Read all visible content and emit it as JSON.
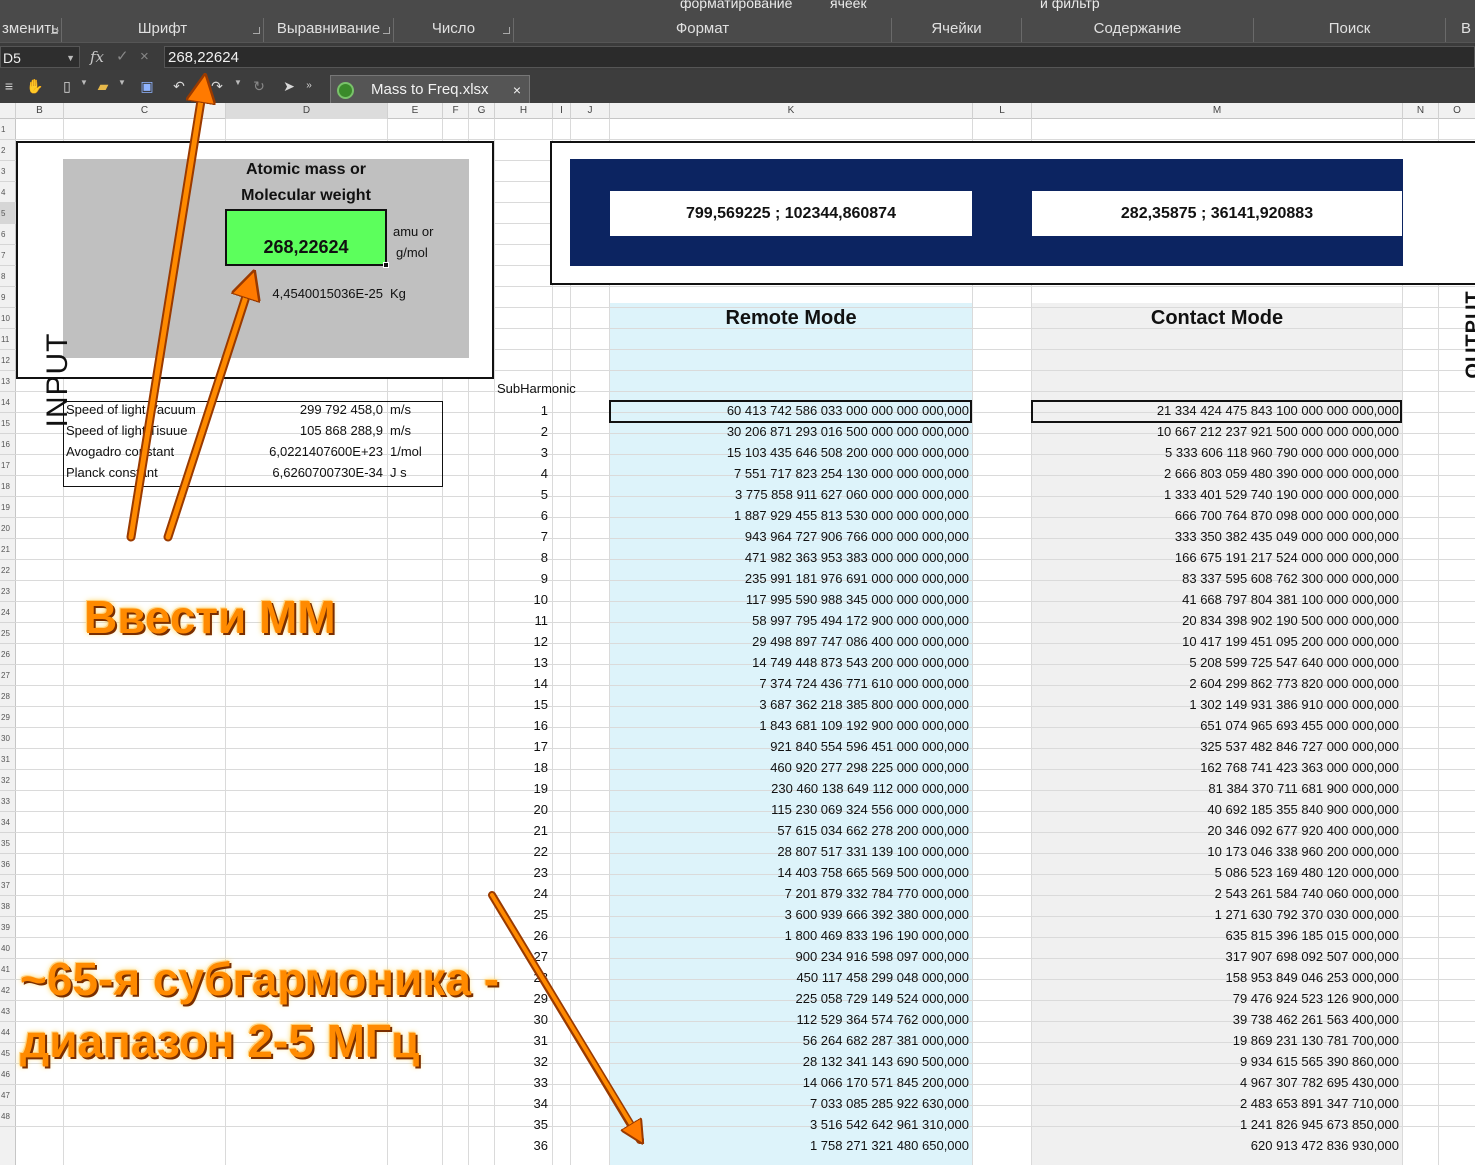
{
  "ribbon": {
    "top_labels": [
      "форматирование",
      "ячеек",
      "и фильтр"
    ],
    "groups": [
      "зменить",
      "Шрифт",
      "Выравнивание",
      "Число",
      "Формат",
      "Ячейки",
      "Содержание",
      "Поиск",
      "В"
    ]
  },
  "formula_bar": {
    "name_box": "D5",
    "fx_label": "fx",
    "value": "268,22624"
  },
  "toolbar": {
    "doc_tab_title": "Mass to Freq.xlsx",
    "doc_tab_close": "×"
  },
  "columns": [
    "B",
    "C",
    "D",
    "E",
    "F",
    "G",
    "H",
    "I",
    "J",
    "K",
    "L",
    "M",
    "N",
    "O"
  ],
  "rows": [
    "1",
    "2",
    "3",
    "4",
    "5",
    "6",
    "7",
    "8",
    "9",
    "10",
    "11",
    "12",
    "13",
    "14",
    "15",
    "16",
    "17",
    "18",
    "19",
    "20",
    "21",
    "22",
    "23",
    "24",
    "25",
    "26",
    "27",
    "28",
    "29",
    "30",
    "31",
    "32",
    "33",
    "34",
    "35",
    "36",
    "37",
    "38",
    "39",
    "40",
    "41",
    "42",
    "43",
    "44",
    "45",
    "46",
    "47",
    "48"
  ],
  "input_panel": {
    "side_label": "INPUT",
    "heading_line1": "Atomic mass or",
    "heading_line2": "Molecular weight",
    "mass_value": "268,22624",
    "unit_line1": "amu or",
    "unit_line2": "g/mol",
    "kg_value": "4,4540015036E-25",
    "kg_unit": "Kg"
  },
  "constants": [
    {
      "name": "Speed of light Vacuum",
      "value": "299 792 458,0",
      "unit": "m/s"
    },
    {
      "name": "Speed of light Tisuue",
      "value": "105 868 288,9",
      "unit": "m/s"
    },
    {
      "name": "Avogadro constant",
      "value": "6,0221407600E+23",
      "unit": "1/mol"
    },
    {
      "name": "Planck constant",
      "value": "6,6260700730E-34",
      "unit": "J s"
    }
  ],
  "output_panel": {
    "side_label": "OUTPUT",
    "remote_output": "799,569225  ;  102344,860874",
    "contact_output": "282,35875  ;  36141,920883"
  },
  "table": {
    "subharmonic_header": "SubHarmonic",
    "remote_header": "Remote Mode",
    "contact_header": "Contact Mode",
    "rows": [
      {
        "n": "1",
        "remote": "60 413 742 586 033 000 000 000 000,000",
        "contact": "21 334 424 475 843 100 000 000 000,000"
      },
      {
        "n": "2",
        "remote": "30 206 871 293 016 500 000 000 000,000",
        "contact": "10 667 212 237 921 500 000 000 000,000"
      },
      {
        "n": "3",
        "remote": "15 103 435 646 508 200 000 000 000,000",
        "contact": "5 333 606 118 960 790 000 000 000,000"
      },
      {
        "n": "4",
        "remote": "7 551 717 823 254 130 000 000 000,000",
        "contact": "2 666 803 059 480 390 000 000 000,000"
      },
      {
        "n": "5",
        "remote": "3 775 858 911 627 060 000 000 000,000",
        "contact": "1 333 401 529 740 190 000 000 000,000"
      },
      {
        "n": "6",
        "remote": "1 887 929 455 813 530 000 000 000,000",
        "contact": "666 700 764 870 098 000 000 000,000"
      },
      {
        "n": "7",
        "remote": "943 964 727 906 766 000 000 000,000",
        "contact": "333 350 382 435 049 000 000 000,000"
      },
      {
        "n": "8",
        "remote": "471 982 363 953 383 000 000 000,000",
        "contact": "166 675 191 217 524 000 000 000,000"
      },
      {
        "n": "9",
        "remote": "235 991 181 976 691 000 000 000,000",
        "contact": "83 337 595 608 762 300 000 000,000"
      },
      {
        "n": "10",
        "remote": "117 995 590 988 345 000 000 000,000",
        "contact": "41 668 797 804 381 100 000 000,000"
      },
      {
        "n": "11",
        "remote": "58 997 795 494 172 900 000 000,000",
        "contact": "20 834 398 902 190 500 000 000,000"
      },
      {
        "n": "12",
        "remote": "29 498 897 747 086 400 000 000,000",
        "contact": "10 417 199 451 095 200 000 000,000"
      },
      {
        "n": "13",
        "remote": "14 749 448 873 543 200 000 000,000",
        "contact": "5 208 599 725 547 640 000 000,000"
      },
      {
        "n": "14",
        "remote": "7 374 724 436 771 610 000 000,000",
        "contact": "2 604 299 862 773 820 000 000,000"
      },
      {
        "n": "15",
        "remote": "3 687 362 218 385 800 000 000,000",
        "contact": "1 302 149 931 386 910 000 000,000"
      },
      {
        "n": "16",
        "remote": "1 843 681 109 192 900 000 000,000",
        "contact": "651 074 965 693 455 000 000,000"
      },
      {
        "n": "17",
        "remote": "921 840 554 596 451 000 000,000",
        "contact": "325 537 482 846 727 000 000,000"
      },
      {
        "n": "18",
        "remote": "460 920 277 298 225 000 000,000",
        "contact": "162 768 741 423 363 000 000,000"
      },
      {
        "n": "19",
        "remote": "230 460 138 649 112 000 000,000",
        "contact": "81 384 370 711 681 900 000,000"
      },
      {
        "n": "20",
        "remote": "115 230 069 324 556 000 000,000",
        "contact": "40 692 185 355 840 900 000,000"
      },
      {
        "n": "21",
        "remote": "57 615 034 662 278 200 000,000",
        "contact": "20 346 092 677 920 400 000,000"
      },
      {
        "n": "22",
        "remote": "28 807 517 331 139 100 000,000",
        "contact": "10 173 046 338 960 200 000,000"
      },
      {
        "n": "23",
        "remote": "14 403 758 665 569 500 000,000",
        "contact": "5 086 523 169 480 120 000,000"
      },
      {
        "n": "24",
        "remote": "7 201 879 332 784 770 000,000",
        "contact": "2 543 261 584 740 060 000,000"
      },
      {
        "n": "25",
        "remote": "3 600 939 666 392 380 000,000",
        "contact": "1 271 630 792 370 030 000,000"
      },
      {
        "n": "26",
        "remote": "1 800 469 833 196 190 000,000",
        "contact": "635 815 396 185 015 000,000"
      },
      {
        "n": "27",
        "remote": "900 234 916 598 097 000,000",
        "contact": "317 907 698 092 507 000,000"
      },
      {
        "n": "28",
        "remote": "450 117 458 299 048 000,000",
        "contact": "158 953 849 046 253 000,000"
      },
      {
        "n": "29",
        "remote": "225 058 729 149 524 000,000",
        "contact": "79 476 924 523 126 900,000"
      },
      {
        "n": "30",
        "remote": "112 529 364 574 762 000,000",
        "contact": "39 738 462 261 563 400,000"
      },
      {
        "n": "31",
        "remote": "56 264 682 287 381 000,000",
        "contact": "19 869 231 130 781 700,000"
      },
      {
        "n": "32",
        "remote": "28 132 341 143 690 500,000",
        "contact": "9 934 615 565 390 860,000"
      },
      {
        "n": "33",
        "remote": "14 066 170 571 845 200,000",
        "contact": "4 967 307 782 695 430,000"
      },
      {
        "n": "34",
        "remote": "7 033 085 285 922 630,000",
        "contact": "2 483 653 891 347 710,000"
      },
      {
        "n": "35",
        "remote": "3 516 542 642 961 310,000",
        "contact": "1 241 826 945 673 850,000"
      },
      {
        "n": "36",
        "remote": "1 758 271 321 480 650,000",
        "contact": "620 913 472 836 930,000"
      }
    ]
  },
  "annotations": {
    "enter_mm": "Ввести ММ",
    "subharmonic_line1": "~65-я субгармоника -",
    "subharmonic_line2": "диапазон 2-5 МГц"
  },
  "colors": {
    "ribbon_bg": "#4a4a4a",
    "input_panel_bg": "#c0c0c0",
    "mass_cell_bg": "#5cff5c",
    "output_band": "#0c2461",
    "remote_column_bg": "#ddf3fa",
    "contact_column_bg": "#f0f0f0",
    "annotation": "#ff8a00"
  }
}
